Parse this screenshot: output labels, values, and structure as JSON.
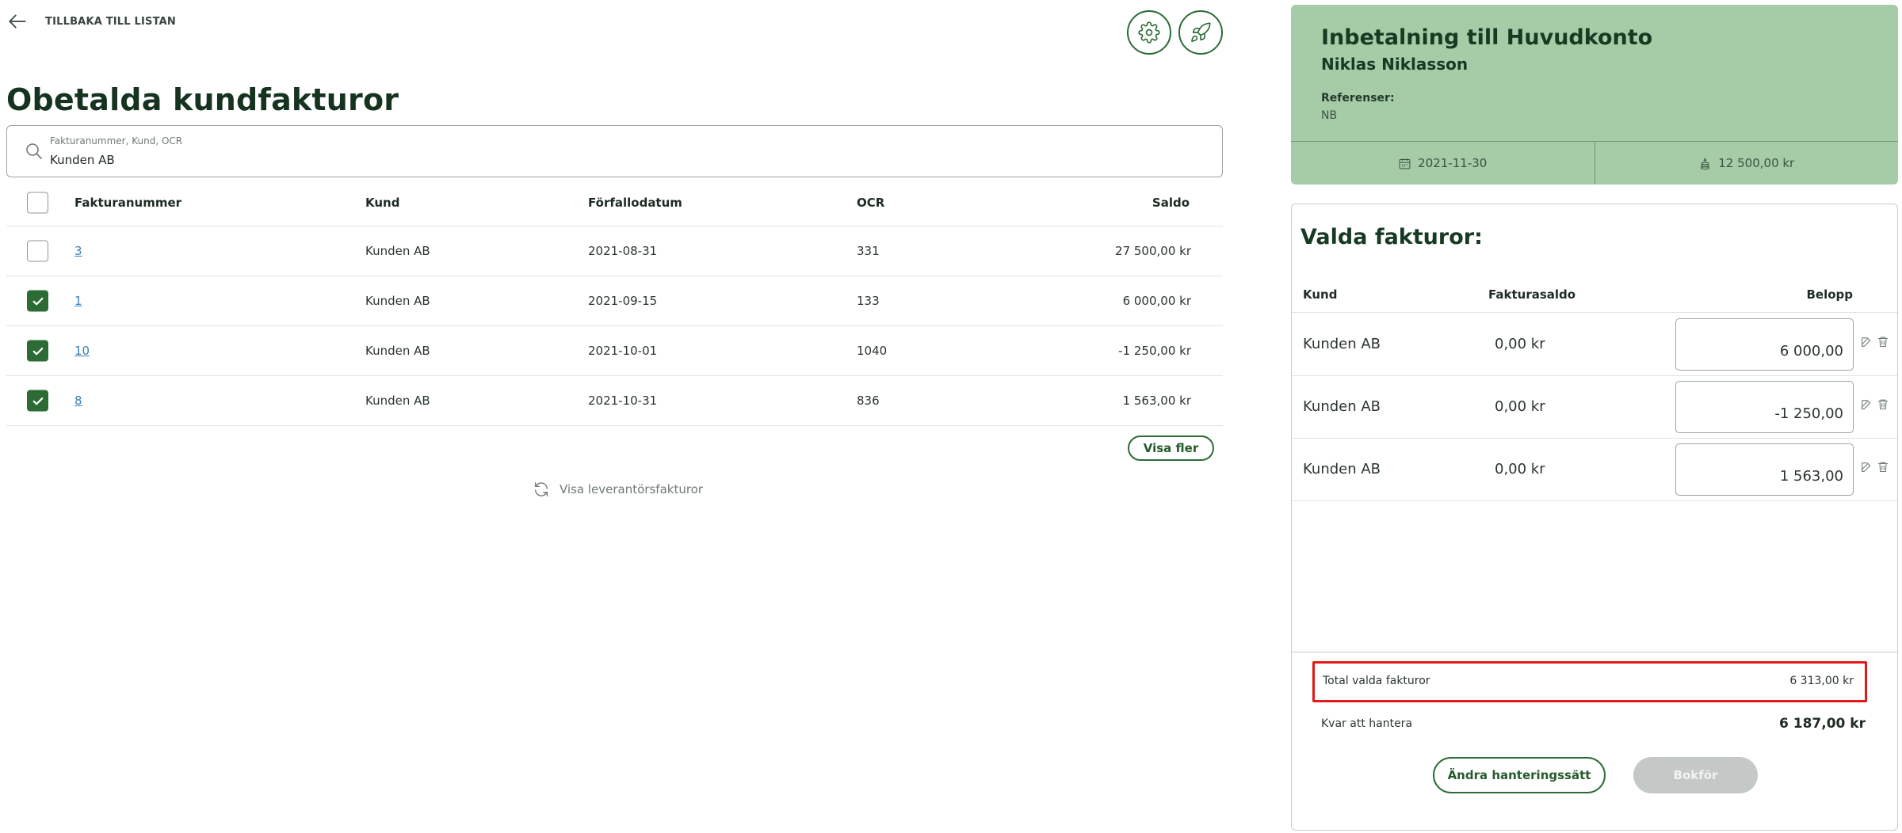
{
  "nav": {
    "back_label": "TILLBAKA TILL LISTAN"
  },
  "page": {
    "title": "Obetalda kundfakturor"
  },
  "search": {
    "placeholder": "Fakturanummer, Kund, OCR",
    "value": "Kunden AB"
  },
  "table": {
    "columns": [
      "Fakturanummer",
      "Kund",
      "Förfallodatum",
      "OCR",
      "Saldo"
    ],
    "rows": [
      {
        "checked": false,
        "number": "3",
        "kund": "Kunden AB",
        "date": "2021-08-31",
        "ocr": "331",
        "saldo": "27 500,00 kr"
      },
      {
        "checked": true,
        "number": "1",
        "kund": "Kunden AB",
        "date": "2021-09-15",
        "ocr": "133",
        "saldo": "6 000,00 kr"
      },
      {
        "checked": true,
        "number": "10",
        "kund": "Kunden AB",
        "date": "2021-10-01",
        "ocr": "1040",
        "saldo": "-1 250,00 kr"
      },
      {
        "checked": true,
        "number": "8",
        "kund": "Kunden AB",
        "date": "2021-10-31",
        "ocr": "836",
        "saldo": "1 563,00 kr"
      }
    ]
  },
  "actions": {
    "visa_fler": "Visa fler",
    "visa_leverantor": "Visa leverantörsfakturor"
  },
  "payment": {
    "title": "Inbetalning till Huvudkonto",
    "name": "Niklas Niklasson",
    "ref_label": "Referenser:",
    "ref_value": "NB",
    "date": "2021-11-30",
    "amount": "12 500,00 kr"
  },
  "selected": {
    "title": "Valda fakturor:",
    "columns": [
      "Kund",
      "Fakturasaldo",
      "Belopp"
    ],
    "rows": [
      {
        "kund": "Kunden AB",
        "fakturasaldo": "0,00 kr",
        "belopp": "6 000,00"
      },
      {
        "kund": "Kunden AB",
        "fakturasaldo": "0,00 kr",
        "belopp": "-1 250,00"
      },
      {
        "kund": "Kunden AB",
        "fakturasaldo": "0,00 kr",
        "belopp": "1 563,00"
      }
    ],
    "total_label": "Total valda fakturor",
    "total_value": "6 313,00 kr",
    "kvar_label": "Kvar att hantera",
    "kvar_value": "6 187,00 kr",
    "btn_andra": "Ändra hanteringssätt",
    "btn_bokfor": "Bokför"
  },
  "colors": {
    "brand_green": "#2c6b34",
    "card_green": "#a6cba7",
    "link_blue": "#3d7fb8",
    "highlight_red": "#e11919"
  },
  "icons": [
    "back-arrow-icon",
    "gear-icon",
    "rocket-icon",
    "search-icon",
    "checkmark-icon",
    "refresh-icon",
    "calendar-icon",
    "coins-icon",
    "edit-icon",
    "trash-icon"
  ]
}
